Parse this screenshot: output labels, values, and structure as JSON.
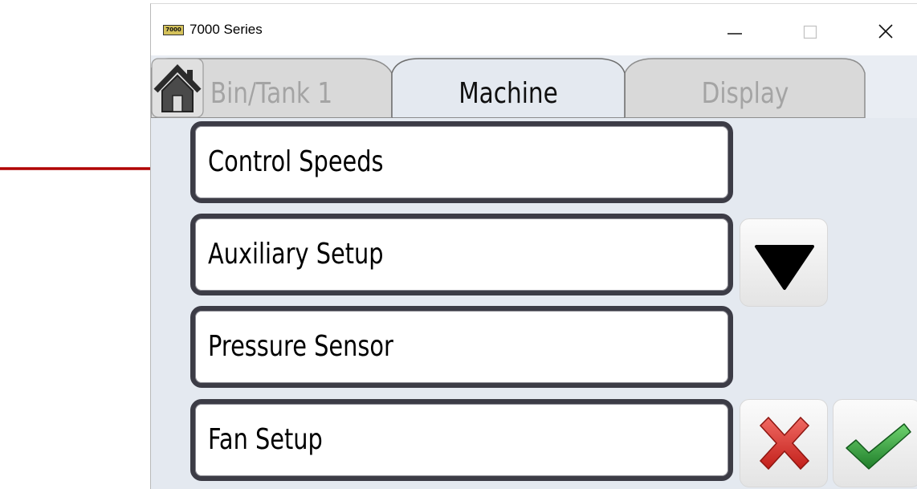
{
  "window": {
    "title": "7000 Series",
    "app_icon_text": "7000"
  },
  "tabs": [
    {
      "label": "Bin/Tank 1",
      "active": false
    },
    {
      "label": "Machine",
      "active": true
    },
    {
      "label": "Display",
      "active": false
    }
  ],
  "menu": {
    "items": [
      {
        "label": "Control Speeds"
      },
      {
        "label": "Auxiliary Setup"
      },
      {
        "label": "Pressure Sensor"
      },
      {
        "label": "Fan Setup"
      }
    ]
  },
  "icons": {
    "home": "home-icon",
    "scroll_down": "triangle-down-icon",
    "cancel": "red-x-icon",
    "confirm": "green-check-icon",
    "annotation_arrow": "red-arrow-icon"
  },
  "colors": {
    "annotation_arrow": "#b00000",
    "content_background": "#e4e9f0",
    "active_tab_text": "#101010",
    "inactive_tab_text": "#a4a4a4",
    "button_border": "#3c3c46",
    "cancel": "#d9302c",
    "confirm": "#2f9a3a"
  }
}
